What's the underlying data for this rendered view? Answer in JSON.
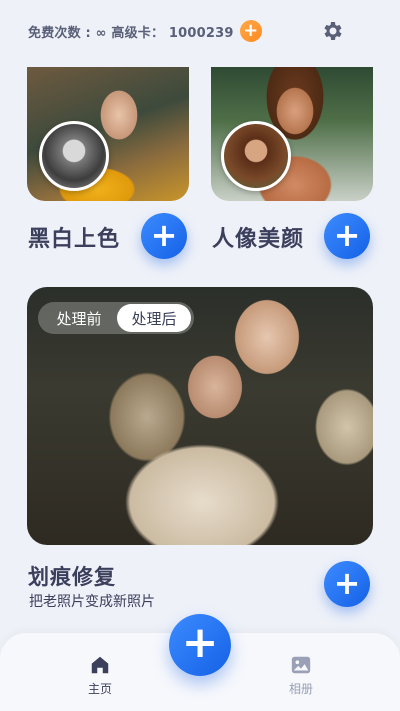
{
  "header": {
    "status_text": "免费次数 : ∞  高级卡： 1000239",
    "add_icon": "plus-icon",
    "settings_icon": "gear-icon"
  },
  "features": [
    {
      "title": "黑白上色",
      "add_icon": "plus-icon"
    },
    {
      "title": "人像美颜",
      "add_icon": "plus-icon"
    }
  ],
  "preview": {
    "toggle_before": "处理前",
    "toggle_after": "处理后",
    "selected": "处理后"
  },
  "scratch": {
    "title": "划痕修复",
    "subtitle": "把老照片变成新照片",
    "add_icon": "plus-icon"
  },
  "bottom_nav": {
    "home_label": "主页",
    "album_label": "相册",
    "center_icon": "plus-icon",
    "active": "主页"
  },
  "colors": {
    "accent_blue": "#1f6ef0",
    "accent_orange": "#ff9a2e",
    "background": "#eef1f8",
    "title_text": "#3b3f5c"
  }
}
